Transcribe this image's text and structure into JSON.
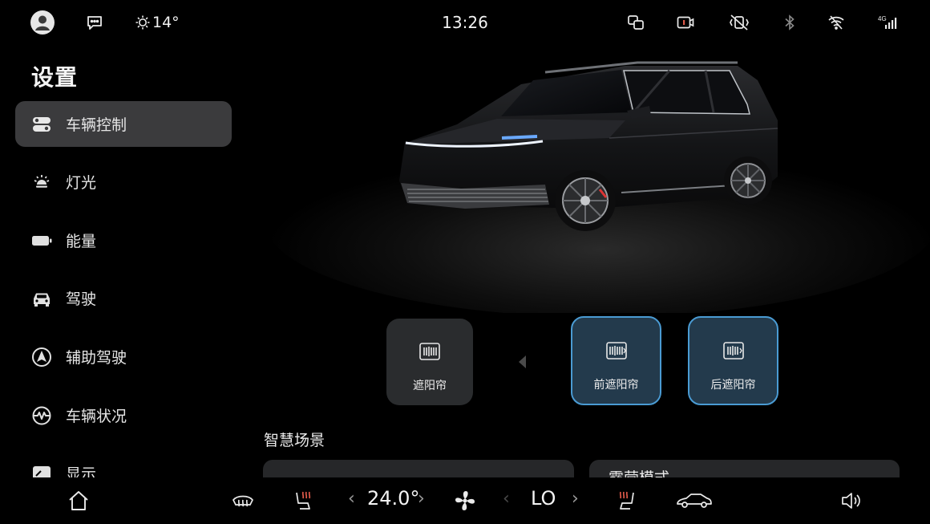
{
  "status_bar": {
    "time": "13:26",
    "temperature": "14°",
    "icons": [
      "avatar-icon",
      "message-icon",
      "sun-icon",
      "screen-mirror-icon",
      "dashcam-icon",
      "vibration-off-icon",
      "bluetooth-icon",
      "wifi-off-icon",
      "signal-4g-icon"
    ],
    "signal_label": "4G"
  },
  "sidebar": {
    "title": "设置",
    "items": [
      {
        "label": "车辆控制",
        "icon": "vehicle-control-icon",
        "active": true
      },
      {
        "label": "灯光",
        "icon": "light-icon",
        "active": false
      },
      {
        "label": "能量",
        "icon": "battery-icon",
        "active": false
      },
      {
        "label": "驾驶",
        "icon": "car-front-icon",
        "active": false
      },
      {
        "label": "辅助驾驶",
        "icon": "assist-drive-icon",
        "active": false
      },
      {
        "label": "车辆状况",
        "icon": "vehicle-status-icon",
        "active": false
      },
      {
        "label": "显示",
        "icon": "display-icon",
        "active": false
      }
    ]
  },
  "sunshade": {
    "main_label": "遮阳帘",
    "front_label": "前遮阳帘",
    "rear_label": "后遮阳帘"
  },
  "smart_scene": {
    "title": "智慧场景",
    "cards": [
      "",
      "露营模式"
    ]
  },
  "dock": {
    "driver_temp": "24.0°",
    "passenger_temp": "LO",
    "icons": [
      "home-icon",
      "rear-defrost-icon",
      "seat-heat-icon",
      "fan-icon",
      "seat-heat-passenger-icon",
      "car-icon",
      "volume-icon"
    ]
  },
  "colors": {
    "accent": "#4a9bd3",
    "active_nav_bg": "#3b3b3d",
    "card_bg": "#2a2c2e",
    "selected_card_bg": "#233a4c",
    "heat_red": "#e05a4a"
  }
}
